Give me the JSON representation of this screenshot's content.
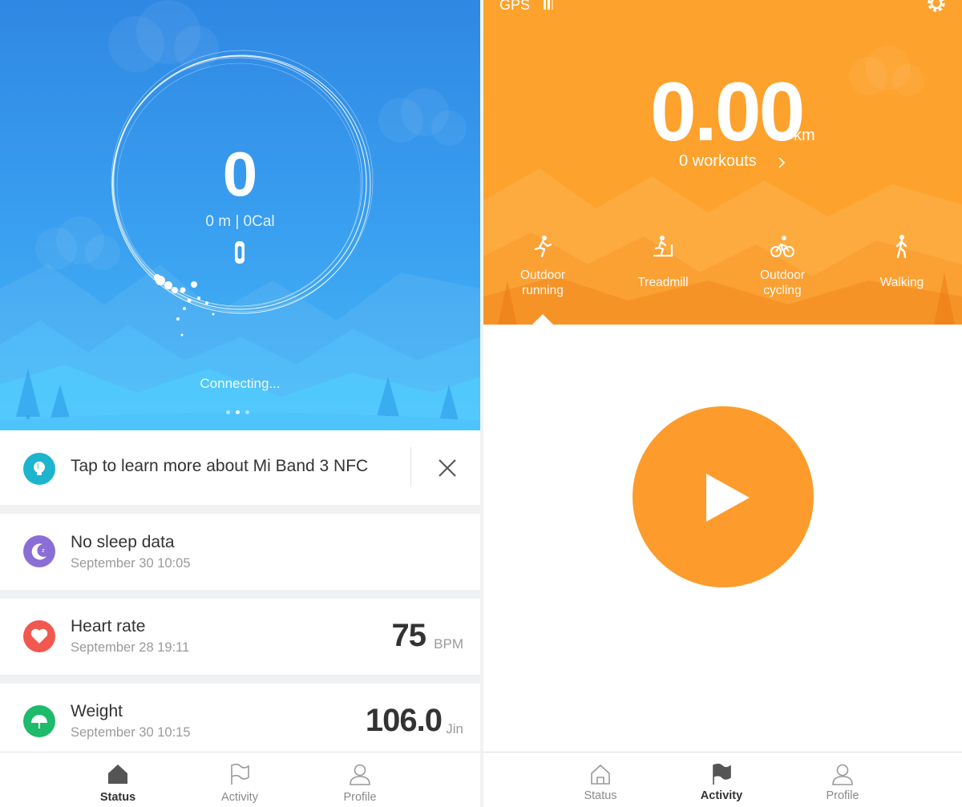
{
  "status_screen": {
    "steps": "0",
    "subline": "0 m | 0Cal",
    "connection_status": "Connecting...",
    "tip": {
      "text": "Tap to learn more about Mi Band 3 NFC"
    },
    "cards": {
      "sleep": {
        "title": "No sleep data",
        "timestamp": "September 30 10:05"
      },
      "heart": {
        "title": "Heart rate",
        "timestamp": "September 28 19:11",
        "value": "75",
        "unit": "BPM"
      },
      "weight": {
        "title": "Weight",
        "timestamp": "September 30 10:15",
        "value": "106.0",
        "unit": "Jin"
      }
    },
    "tabs": [
      {
        "label": "Status",
        "icon": "home-icon",
        "active": true
      },
      {
        "label": "Activity",
        "icon": "flag-icon",
        "active": false
      },
      {
        "label": "Profile",
        "icon": "person-icon",
        "active": false
      }
    ]
  },
  "activity_screen": {
    "gps_label": "GPS",
    "distance": "0.00",
    "distance_unit": "km",
    "workouts": "0 workouts",
    "activities": [
      {
        "label_line1": "Outdoor",
        "label_line2": "running",
        "icon": "running-icon",
        "selected": true
      },
      {
        "label_line1": "Treadmill",
        "label_line2": "",
        "icon": "treadmill-icon",
        "selected": false
      },
      {
        "label_line1": "Outdoor",
        "label_line2": "cycling",
        "icon": "cycling-icon",
        "selected": false
      },
      {
        "label_line1": "Walking",
        "label_line2": "",
        "icon": "walking-icon",
        "selected": false
      }
    ],
    "tabs": [
      {
        "label": "Status",
        "icon": "home-icon",
        "active": false
      },
      {
        "label": "Activity",
        "icon": "flag-icon",
        "active": true
      },
      {
        "label": "Profile",
        "icon": "person-icon",
        "active": false
      }
    ]
  },
  "colors": {
    "status_blue": "#2f88e3",
    "activity_orange": "#fda22c",
    "tip_teal": "#1db4cd",
    "sleep_purple": "#8a6ed6",
    "heart_red": "#f1584f",
    "weight_green": "#1dbb6a"
  }
}
